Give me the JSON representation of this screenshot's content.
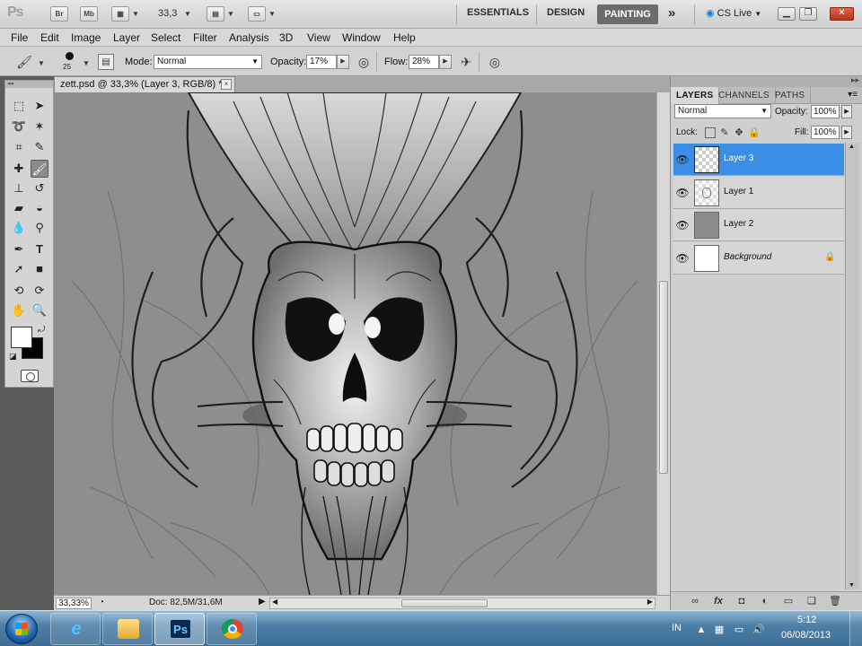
{
  "appbar": {
    "logo": "Ps",
    "bridge_label": "Br",
    "minibridge_label": "Mb",
    "zoom_value": "33,3",
    "workspaces": [
      "ESSENTIALS",
      "DESIGN"
    ],
    "active_workspace": "PAINTING",
    "more_label": "»",
    "cs_live_label": "CS Live"
  },
  "menu": [
    "File",
    "Edit",
    "Image",
    "Layer",
    "Select",
    "Filter",
    "Analysis",
    "3D",
    "View",
    "Window",
    "Help"
  ],
  "options": {
    "brush_size": "25",
    "mode_label": "Mode:",
    "mode_value": "Normal",
    "opacity_label": "Opacity:",
    "opacity_value": "17%",
    "flow_label": "Flow:",
    "flow_value": "28%"
  },
  "document": {
    "tab_title": "zett.psd @ 33,3% (Layer 3, RGB/8) *",
    "close_glyph": "×",
    "status_zoom": "33,33%",
    "status_doc": "Doc: 82,5M/31,6M"
  },
  "layers_panel": {
    "tabs": [
      "LAYERS",
      "CHANNELS",
      "PATHS"
    ],
    "active_tab": "LAYERS",
    "blend_mode": "Normal",
    "opacity_label": "Opacity:",
    "opacity_value": "100%",
    "lock_label": "Lock:",
    "fill_label": "Fill:",
    "fill_value": "100%",
    "layers": [
      {
        "name": "Layer 3",
        "selected": true,
        "thumb": "transparent"
      },
      {
        "name": "Layer 1",
        "selected": false,
        "thumb": "sketch"
      },
      {
        "name": "Layer 2",
        "selected": false,
        "thumb": "gray"
      },
      {
        "name": "Background",
        "selected": false,
        "thumb": "white",
        "locked": true
      }
    ]
  },
  "taskbar": {
    "apps": [
      "internet-explorer",
      "windows-explorer",
      "photoshop",
      "chrome"
    ],
    "ps_label": "Ps",
    "lang": "IN",
    "time": "5:12",
    "date": "06/08/2013"
  },
  "colors": {
    "selection_blue": "#3b8ee5",
    "canvas_gray": "#8c8c8c",
    "active_workspace_bg": "#6b6b6b"
  }
}
